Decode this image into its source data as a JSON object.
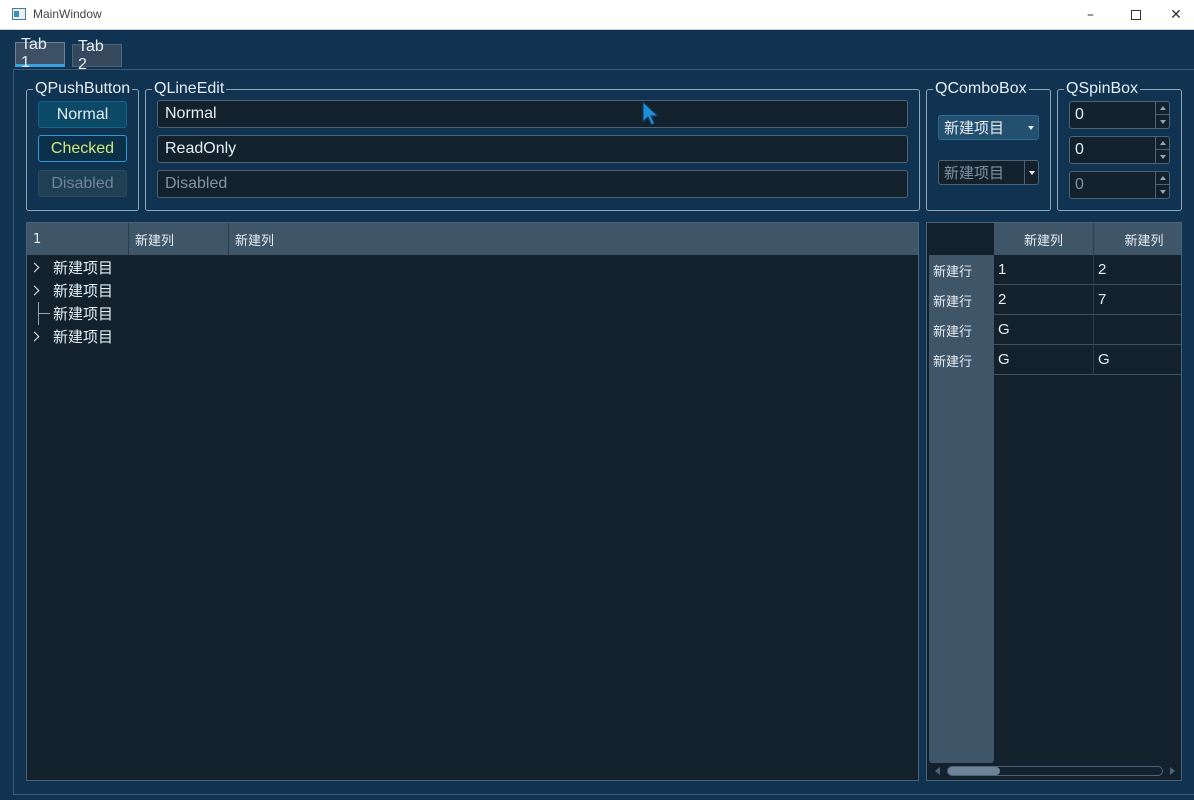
{
  "window": {
    "title": "MainWindow",
    "minimize": "–",
    "close": "✕"
  },
  "tabs": [
    {
      "label": "Tab 1"
    },
    {
      "label": "Tab 2"
    }
  ],
  "push_buttons": {
    "group_title": "QPushButton",
    "normal": "Normal",
    "checked": "Checked",
    "disabled": "Disabled"
  },
  "line_edits": {
    "group_title": "QLineEdit",
    "normal": "Normal",
    "readonly": "ReadOnly",
    "disabled": "Disabled"
  },
  "combo_boxes": {
    "group_title": "QComboBox",
    "active_value": "新建项目",
    "disabled_value": "新建项目"
  },
  "spin_boxes": {
    "group_title": "QSpinBox",
    "values": [
      "0",
      "0",
      "0"
    ]
  },
  "tree": {
    "headers": [
      "1",
      "新建列",
      "新建列"
    ],
    "items": [
      {
        "label": "新建项目",
        "branch": "collapsed"
      },
      {
        "label": "新建项目",
        "branch": "collapsed"
      },
      {
        "label": "新建项目",
        "branch": "leaf"
      },
      {
        "label": "新建项目",
        "branch": "collapsed"
      }
    ]
  },
  "table": {
    "column_headers": [
      "新建列",
      "新建列"
    ],
    "row_headers": [
      "新建行",
      "新建行",
      "新建行",
      "新建行"
    ],
    "rows": [
      [
        "1",
        "2"
      ],
      [
        "2",
        "7"
      ],
      [
        "G",
        ""
      ],
      [
        "G",
        "G"
      ]
    ]
  },
  "colors": {
    "background": "#0f3350",
    "field": "#13212c",
    "header": "#3f5568",
    "accent": "#3aa3e0",
    "checked_text": "#cfe87a"
  }
}
